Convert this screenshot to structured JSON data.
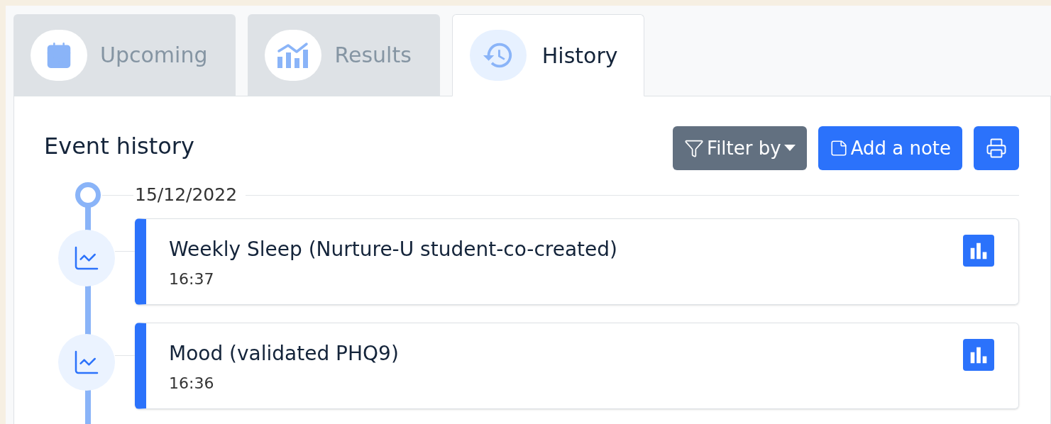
{
  "tabs": [
    {
      "label": "Upcoming",
      "kind": "calendar",
      "selected": false
    },
    {
      "label": "Results",
      "kind": "chart",
      "selected": false
    },
    {
      "label": "History",
      "kind": "history",
      "selected": true
    }
  ],
  "panel": {
    "title": "Event history",
    "buttons": [
      {
        "kind": "filter",
        "label": "Filter by"
      },
      {
        "kind": "note",
        "label": "Add a note"
      },
      {
        "kind": "print"
      }
    ]
  },
  "timeline": {
    "date": "15/12/2022",
    "events": [
      {
        "title": "Weekly Sleep (Nurture-U student-co-created)",
        "time": "16:37"
      },
      {
        "title": "Mood (validated PHQ9)",
        "time": "16:36"
      }
    ]
  }
}
